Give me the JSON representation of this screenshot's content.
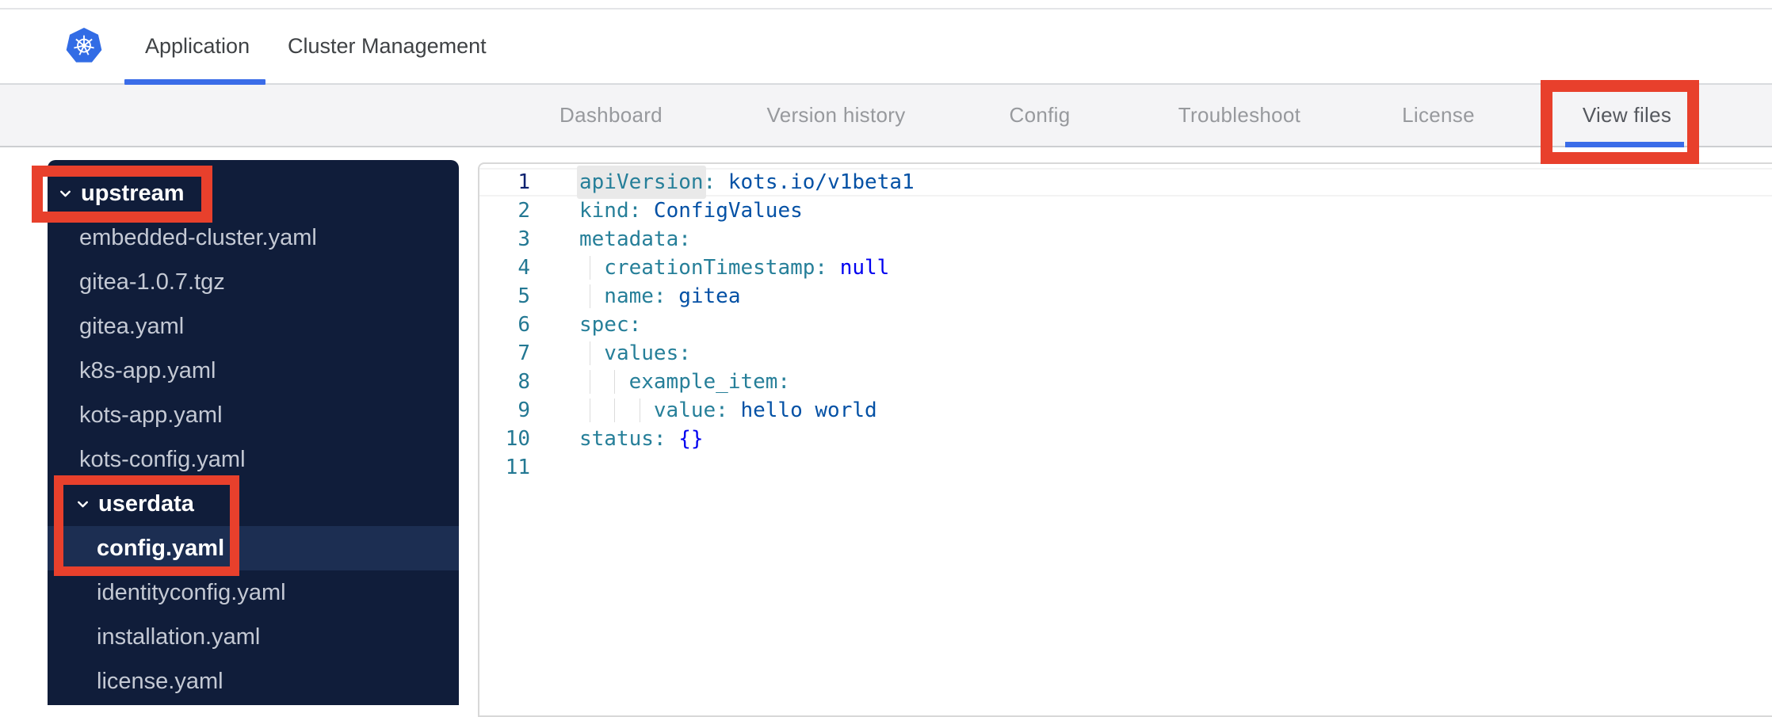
{
  "topbar": {
    "logo_icon": "kubernetes-logo",
    "tabs": [
      {
        "label": "Application",
        "active": true
      },
      {
        "label": "Cluster Management",
        "active": false
      }
    ]
  },
  "subnav": {
    "items": [
      {
        "label": "Dashboard",
        "active": false
      },
      {
        "label": "Version history",
        "active": false
      },
      {
        "label": "Config",
        "active": false
      },
      {
        "label": "Troubleshoot",
        "active": false
      },
      {
        "label": "License",
        "active": false
      },
      {
        "label": "View files",
        "active": true
      }
    ]
  },
  "annotations": {
    "color": "#e8402c",
    "boxes": [
      "view-files-tab",
      "upstream-folder",
      "userdata-folder-and-config-yaml"
    ]
  },
  "file_tree": [
    {
      "label": "upstream",
      "type": "dir",
      "depth": 0,
      "selected": false
    },
    {
      "label": "embedded-cluster.yaml",
      "type": "file",
      "depth": 1,
      "selected": false
    },
    {
      "label": "gitea-1.0.7.tgz",
      "type": "file",
      "depth": 1,
      "selected": false
    },
    {
      "label": "gitea.yaml",
      "type": "file",
      "depth": 1,
      "selected": false
    },
    {
      "label": "k8s-app.yaml",
      "type": "file",
      "depth": 1,
      "selected": false
    },
    {
      "label": "kots-app.yaml",
      "type": "file",
      "depth": 1,
      "selected": false
    },
    {
      "label": "kots-config.yaml",
      "type": "file",
      "depth": 1,
      "selected": false
    },
    {
      "label": "userdata",
      "type": "dir",
      "depth": 1,
      "selected": false
    },
    {
      "label": "config.yaml",
      "type": "file",
      "depth": 2,
      "selected": true
    },
    {
      "label": "identityconfig.yaml",
      "type": "file",
      "depth": 2,
      "selected": false
    },
    {
      "label": "installation.yaml",
      "type": "file",
      "depth": 2,
      "selected": false
    },
    {
      "label": "license.yaml",
      "type": "file",
      "depth": 2,
      "selected": false
    }
  ],
  "editor": {
    "language": "yaml",
    "colors": {
      "key": "#267f99",
      "string": "#0451a5",
      "keyword": "#0000f0",
      "line_number": "#237893",
      "active_line_number": "#0b216f"
    },
    "lines": [
      {
        "num": 1,
        "indent": 0,
        "active": true,
        "tokens": [
          {
            "c": "key",
            "t": "apiVersion",
            "h": true
          },
          {
            "c": "key",
            "t": ": "
          },
          {
            "c": "str",
            "t": "kots.io/v1beta1"
          }
        ]
      },
      {
        "num": 2,
        "indent": 0,
        "active": false,
        "tokens": [
          {
            "c": "key",
            "t": "kind: "
          },
          {
            "c": "str",
            "t": "ConfigValues"
          }
        ]
      },
      {
        "num": 3,
        "indent": 0,
        "active": false,
        "tokens": [
          {
            "c": "key",
            "t": "metadata:"
          }
        ]
      },
      {
        "num": 4,
        "indent": 1,
        "active": false,
        "tokens": [
          {
            "c": "key",
            "t": "creationTimestamp: "
          },
          {
            "c": "kw",
            "t": "null"
          }
        ]
      },
      {
        "num": 5,
        "indent": 1,
        "active": false,
        "tokens": [
          {
            "c": "key",
            "t": "name: "
          },
          {
            "c": "str",
            "t": "gitea"
          }
        ]
      },
      {
        "num": 6,
        "indent": 0,
        "active": false,
        "tokens": [
          {
            "c": "key",
            "t": "spec:"
          }
        ]
      },
      {
        "num": 7,
        "indent": 1,
        "active": false,
        "tokens": [
          {
            "c": "key",
            "t": "values:"
          }
        ]
      },
      {
        "num": 8,
        "indent": 2,
        "active": false,
        "tokens": [
          {
            "c": "key",
            "t": "example_item:"
          }
        ]
      },
      {
        "num": 9,
        "indent": 3,
        "active": false,
        "tokens": [
          {
            "c": "key",
            "t": "value: "
          },
          {
            "c": "str",
            "t": "hello world"
          }
        ]
      },
      {
        "num": 10,
        "indent": 0,
        "active": false,
        "tokens": [
          {
            "c": "key",
            "t": "status: "
          },
          {
            "c": "kw",
            "t": "{}"
          }
        ]
      },
      {
        "num": 11,
        "indent": 0,
        "active": false,
        "tokens": []
      }
    ]
  }
}
